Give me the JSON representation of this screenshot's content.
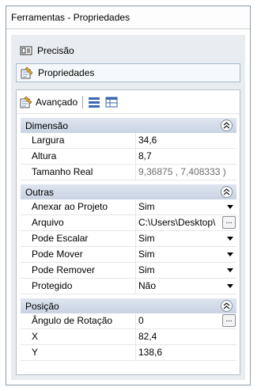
{
  "window": {
    "title": "Ferramentas - Propriedades"
  },
  "nav": {
    "items": [
      {
        "label": "Precisão",
        "icon": "precision-icon"
      },
      {
        "label": "Propriedades",
        "icon": "properties-icon"
      }
    ]
  },
  "toolbar": {
    "advanced_label": "Avançado"
  },
  "sections": {
    "dimensao": {
      "title": "Dimensão",
      "rows": [
        {
          "name": "Largura",
          "value": "34,6"
        },
        {
          "name": "Altura",
          "value": "8,7"
        },
        {
          "name": "Tamanho Real",
          "value": "9,36875 , 7,408333 )"
        }
      ]
    },
    "outras": {
      "title": "Outras",
      "rows": [
        {
          "name": "Anexar ao Projeto",
          "value": "Sim"
        },
        {
          "name": "Arquivo",
          "value": "C:\\Users\\Desktop\\"
        },
        {
          "name": "Pode Escalar",
          "value": "Sim"
        },
        {
          "name": "Pode Mover",
          "value": "Sim"
        },
        {
          "name": "Pode Remover",
          "value": "Sim"
        },
        {
          "name": "Protegido",
          "value": "Não"
        }
      ]
    },
    "posicao": {
      "title": "Posição",
      "rows": [
        {
          "name": "Ângulo de Rotação",
          "value": "0"
        },
        {
          "name": "X",
          "value": "82,4"
        },
        {
          "name": "Y",
          "value": "138,6"
        }
      ]
    }
  },
  "ellipsis": "...",
  "colors": {
    "category_bg": "#c8d3e3",
    "selected_border": "#a6bccf"
  }
}
